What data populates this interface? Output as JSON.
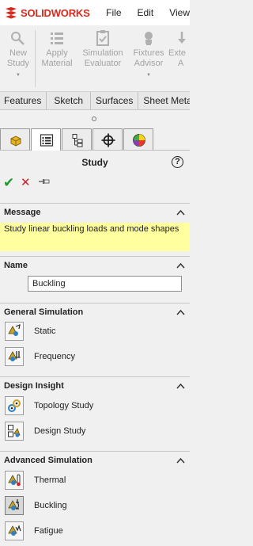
{
  "app": {
    "logo_text": "SOLIDWORKS",
    "menus": [
      "File",
      "Edit",
      "View"
    ]
  },
  "commands": [
    {
      "line1": "New",
      "line2": "Study",
      "icon": "new-study-icon"
    },
    {
      "line1": "Apply",
      "line2": "Material",
      "icon": "apply-material-icon"
    },
    {
      "line1": "Simulation",
      "line2": "Evaluator",
      "icon": "simulation-evaluator-icon"
    },
    {
      "line1": "Fixtures",
      "line2": "Advisor",
      "icon": "fixtures-advisor-icon"
    },
    {
      "line1": "Exte",
      "line2": "A",
      "icon": "external-loads-icon"
    }
  ],
  "tabs": [
    "Features",
    "Sketch",
    "Surfaces",
    "Sheet Metal"
  ],
  "panel_tabs": [
    "featuremanager-tab",
    "propertymanager-tab",
    "configurationmanager-tab",
    "dimxpertmanager-tab",
    "displaymanager-tab"
  ],
  "property_manager": {
    "title": "Study",
    "help": "?",
    "ok": "✔",
    "cancel": "✕",
    "pin": "pin-icon"
  },
  "message": {
    "header": "Message",
    "text": "Study linear buckling loads and mode shapes"
  },
  "name": {
    "header": "Name",
    "value": "Buckling"
  },
  "general_simulation": {
    "header": "General Simulation",
    "items": [
      {
        "label": "Static",
        "icon": "static-study-icon"
      },
      {
        "label": "Frequency",
        "icon": "frequency-study-icon"
      }
    ]
  },
  "design_insight": {
    "header": "Design Insight",
    "items": [
      {
        "label": "Topology Study",
        "icon": "topology-study-icon"
      },
      {
        "label": "Design Study",
        "icon": "design-study-icon"
      }
    ]
  },
  "advanced_simulation": {
    "header": "Advanced Simulation",
    "items": [
      {
        "label": "Thermal",
        "icon": "thermal-study-icon"
      },
      {
        "label": "Buckling",
        "icon": "buckling-study-icon",
        "selected": true
      },
      {
        "label": "Fatigue",
        "icon": "fatigue-study-icon"
      }
    ]
  },
  "colors": {
    "logo_red": "#d52b1e",
    "message_bg": "#ffffa0",
    "ok_green": "#1e9b2f",
    "cancel_red": "#d0202a"
  }
}
